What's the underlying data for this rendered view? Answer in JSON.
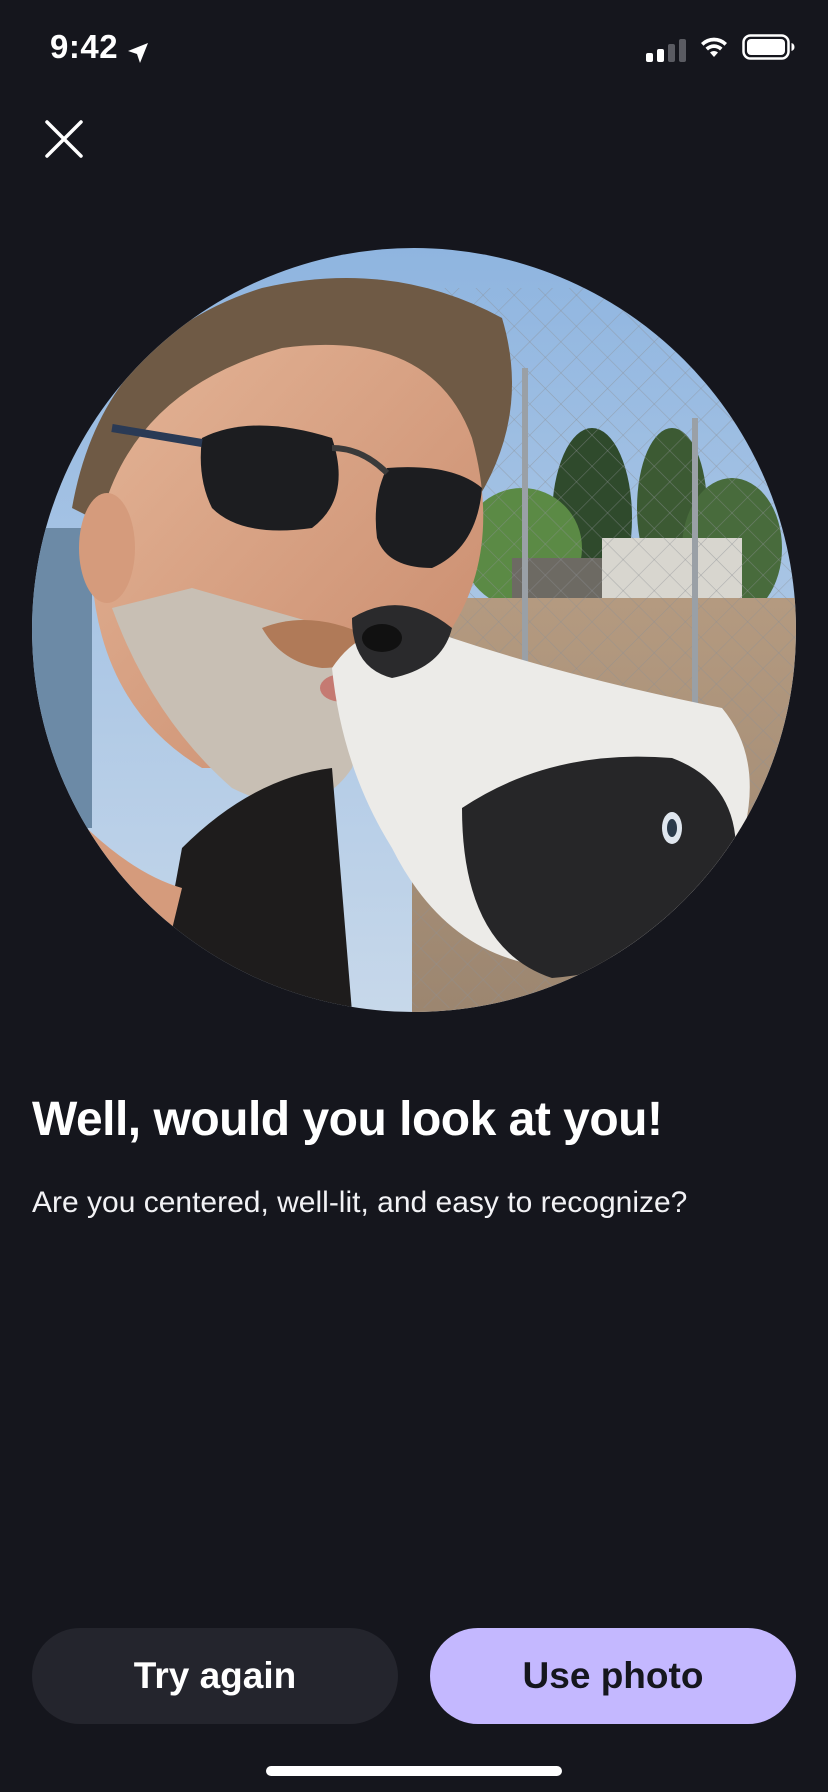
{
  "status_bar": {
    "time": "9:42",
    "location_icon": "location-arrow-icon",
    "signal_icon": "cellular-signal-icon",
    "wifi_icon": "wifi-icon",
    "battery_icon": "battery-icon"
  },
  "close": {
    "icon": "close-icon"
  },
  "photo": {
    "alt": "circular selfie preview of a man in sunglasses kissing a black and white dog"
  },
  "content": {
    "headline": "Well, would you look at you!",
    "subtext": "Are you centered, well-lit, and easy to recognize?"
  },
  "actions": {
    "try_again_label": "Try again",
    "use_photo_label": "Use photo"
  },
  "colors": {
    "background": "#15161d",
    "secondary_button": "#24252d",
    "primary_button": "#c4b8ff",
    "text": "#ffffff"
  }
}
